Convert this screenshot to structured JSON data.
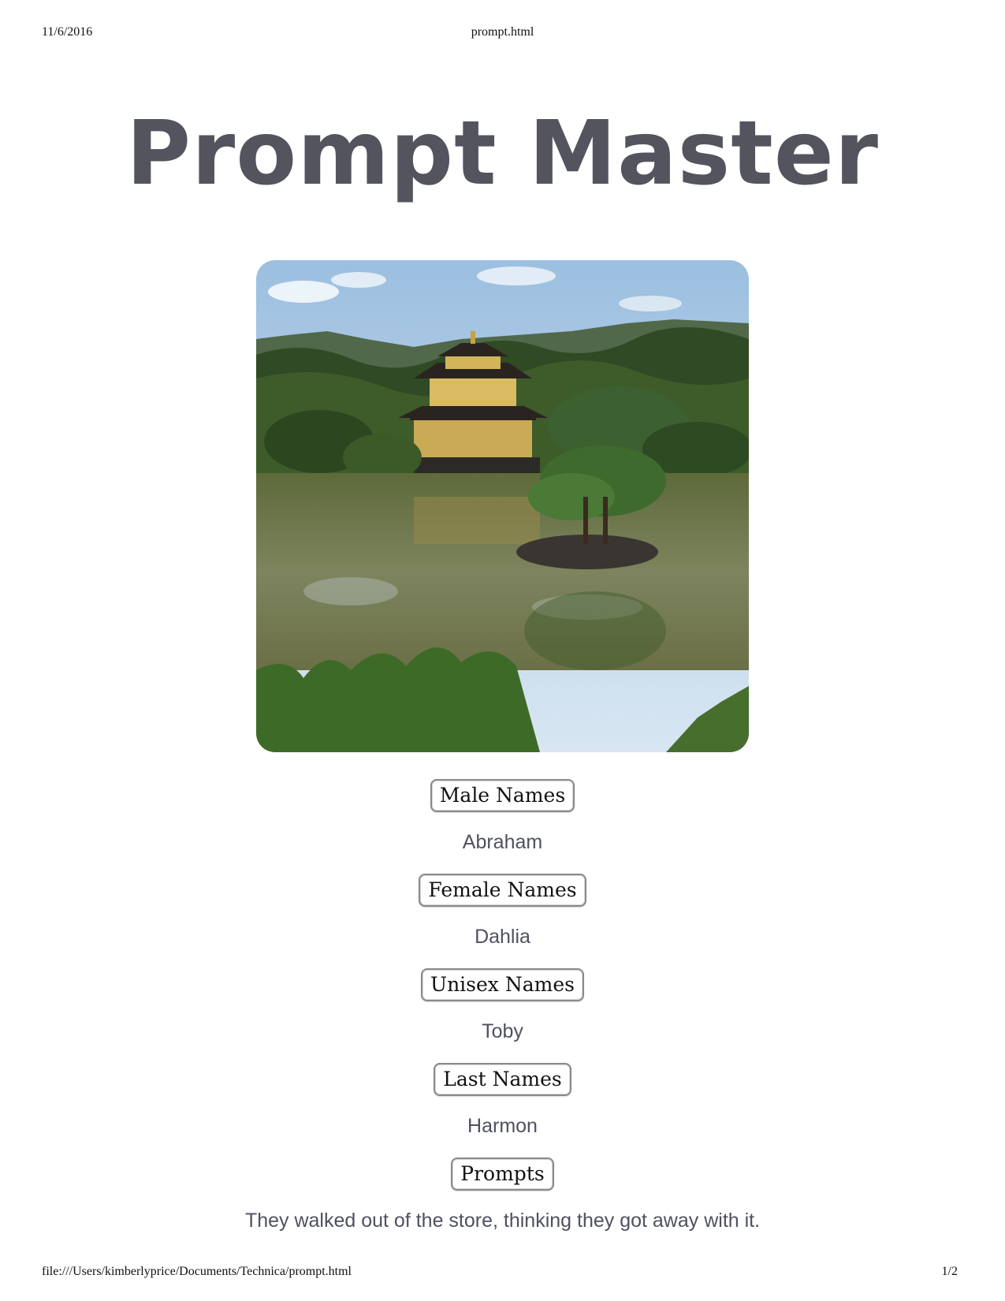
{
  "print_header": {
    "date": "11/6/2016",
    "page_title": "prompt.html"
  },
  "print_footer": {
    "url": "file:///Users/kimberlyprice/Documents/Technica/prompt.html",
    "page_number": "1/2"
  },
  "page": {
    "title": "Prompt Master"
  },
  "image": {
    "icon": "temple-landscape-photo"
  },
  "generators": [
    {
      "button_label": "Male Names",
      "result": "Abraham"
    },
    {
      "button_label": "Female Names",
      "result": "Dahlia"
    },
    {
      "button_label": "Unisex Names",
      "result": "Toby"
    },
    {
      "button_label": "Last Names",
      "result": "Harmon"
    },
    {
      "button_label": "Prompts",
      "result": "They walked out of the store, thinking they got away with it."
    }
  ],
  "colors": {
    "title": "#53545e",
    "result_text": "#4f5160"
  }
}
